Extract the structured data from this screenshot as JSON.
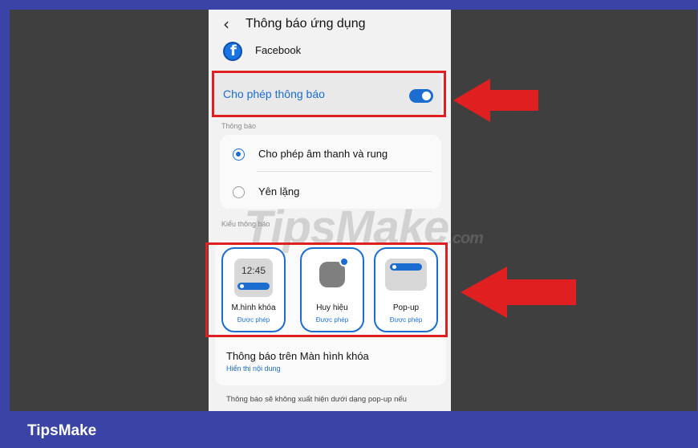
{
  "header": {
    "back_icon": "chevron-left-icon",
    "title": "Thông báo ứng dụng"
  },
  "app": {
    "icon": "facebook-icon",
    "name": "Facebook"
  },
  "allow": {
    "label": "Cho phép thông báo",
    "enabled": true
  },
  "notifications": {
    "section_label": "Thông báo",
    "options": [
      {
        "label": "Cho phép âm thanh và rung",
        "selected": true
      },
      {
        "label": "Yên lặng",
        "selected": false
      }
    ]
  },
  "style": {
    "section_label": "Kiểu thông báo",
    "lock_time": "12:45",
    "items": [
      {
        "name": "M.hình khóa",
        "status": "Được phép"
      },
      {
        "name": "Huy hiệu",
        "status": "Được phép"
      },
      {
        "name": "Pop-up",
        "status": "Được phép"
      }
    ]
  },
  "lockscreen": {
    "title": "Thông báo trên Màn hình khóa",
    "value": "Hiển thị nội dung"
  },
  "footnote": "Thông báo sẽ không xuất hiện dưới dạng pop-up nếu",
  "watermark": {
    "main": "TipsMake",
    "suffix": ".com"
  },
  "brand": "TipsMake",
  "colors": {
    "accent": "#1c6dd0",
    "highlight": "#e02020",
    "frame": "#3a44a6"
  }
}
